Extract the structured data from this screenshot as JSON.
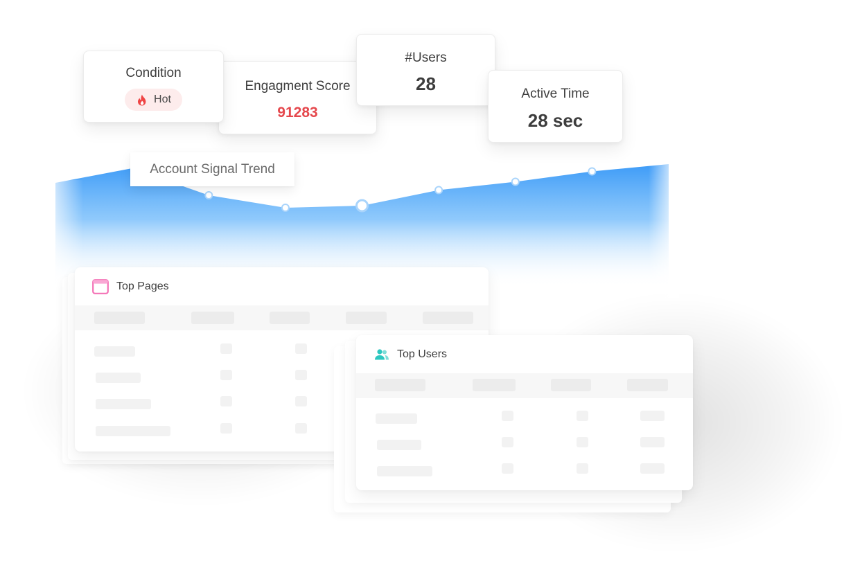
{
  "metrics": {
    "condition": {
      "label": "Condition",
      "badge": "Hot",
      "badge_icon": "flame-icon"
    },
    "engagement": {
      "label": "Engagment Score",
      "value": "91283"
    },
    "users": {
      "label": "#Users",
      "value": "28"
    },
    "active_time": {
      "label": "Active Time",
      "value": "28 sec"
    }
  },
  "trend": {
    "label": "Account Signal Trend",
    "color": "#3d9bf7",
    "values": [
      0.74,
      0.88,
      0.62,
      0.5,
      0.52,
      0.67,
      0.75,
      0.85,
      0.92
    ]
  },
  "panels": {
    "top_pages": {
      "title": "Top Pages",
      "icon": "browser-window-icon",
      "icon_color": "#f472b6"
    },
    "top_users": {
      "title": "Top Users",
      "icon": "users-icon",
      "icon_color": "#2cc7c0"
    }
  },
  "colors": {
    "engagement_value": "#e5484d",
    "badge_bg": "#fdecec"
  }
}
